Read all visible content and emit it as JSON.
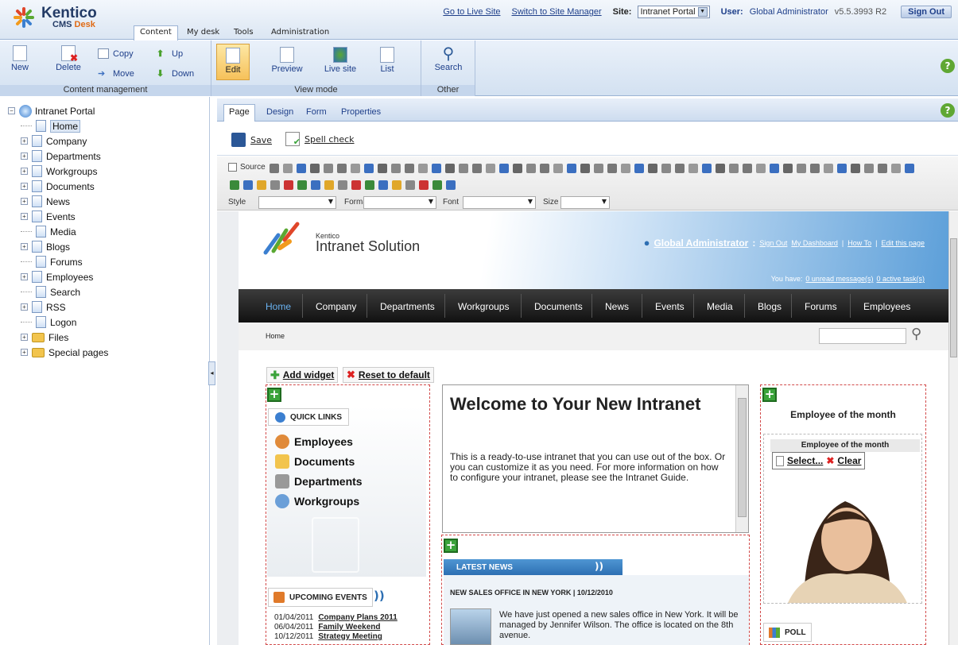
{
  "app": {
    "logo_text": "Kentico",
    "logo_sub_1": "CMS",
    "logo_sub_2": "Desk"
  },
  "main_tabs": [
    {
      "label": "Content"
    },
    {
      "label": "My desk"
    },
    {
      "label": "Tools"
    },
    {
      "label": "Administration"
    }
  ],
  "top_links": {
    "live_site": "Go to Live Site",
    "site_manager": "Switch to Site Manager",
    "site_label": "Site:",
    "site_value": "Intranet Portal",
    "user_label": "User:",
    "user_value": "Global Administrator",
    "version": "v5.5.3993 R2",
    "sign_out": "Sign Out"
  },
  "ribbon": {
    "content_management": {
      "label": "Content management",
      "new": "New",
      "delete": "Delete",
      "copy": "Copy",
      "move": "Move",
      "up": "Up",
      "down": "Down"
    },
    "view_mode": {
      "label": "View mode",
      "edit": "Edit",
      "preview": "Preview",
      "live_site": "Live site",
      "list": "List"
    },
    "other": {
      "label": "Other",
      "search": "Search"
    },
    "help": "?"
  },
  "tree": {
    "root": "Intranet Portal",
    "items": [
      {
        "label": "Home",
        "expandable": false,
        "selected": true
      },
      {
        "label": "Company",
        "expandable": true
      },
      {
        "label": "Departments",
        "expandable": true
      },
      {
        "label": "Workgroups",
        "expandable": true
      },
      {
        "label": "Documents",
        "expandable": true
      },
      {
        "label": "News",
        "expandable": true
      },
      {
        "label": "Events",
        "expandable": true
      },
      {
        "label": "Media",
        "expandable": false
      },
      {
        "label": "Blogs",
        "expandable": true
      },
      {
        "label": "Forums",
        "expandable": false
      },
      {
        "label": "Employees",
        "expandable": true
      },
      {
        "label": "Search",
        "expandable": false
      },
      {
        "label": "RSS",
        "expandable": true
      },
      {
        "label": "Logon",
        "expandable": false
      },
      {
        "label": "Files",
        "expandable": true,
        "folder": true
      },
      {
        "label": "Special pages",
        "expandable": true,
        "folder": true
      }
    ]
  },
  "edit_tabs": [
    {
      "label": "Page"
    },
    {
      "label": "Design"
    },
    {
      "label": "Form"
    },
    {
      "label": "Properties"
    }
  ],
  "savebar": {
    "save": "Save",
    "spell_check": "Spell check"
  },
  "editor_toolbar": {
    "source": "Source",
    "style": "Style",
    "format": "Format",
    "font": "Font",
    "size": "Size"
  },
  "site": {
    "brand_small": "Kentico",
    "brand": "Intranet Solution",
    "user": "Global Administrator",
    "header_links": [
      "Sign Out",
      "My Dashboard",
      "How To",
      "Edit this page"
    ],
    "messages_prefix": "You have:",
    "unread": "0 unread message(s)",
    "tasks": "0 active task(s)",
    "nav": [
      "Home",
      "Company",
      "Departments",
      "Workgroups",
      "Documents",
      "News",
      "Events",
      "Media",
      "Blogs",
      "Forums",
      "Employees"
    ],
    "breadcrumb": "Home",
    "add_widget": "Add widget",
    "reset_default": "Reset to default",
    "quick_links_title": "QUICK LINKS",
    "quick_links": [
      "Employees",
      "Documents",
      "Departments",
      "Workgroups"
    ],
    "welcome_title": "Welcome to Your New Intranet",
    "welcome_text": "This is a ready-to-use intranet that you can use out of the box. Or you can customize it as you need. For more information on how to configure your intranet, please see the Intranet Guide.",
    "employee_heading": "Employee of the month",
    "employee_box_title": "Employee of the month",
    "select": "Select...",
    "clear": "Clear",
    "latest_news": "LATEST NEWS",
    "news_headline": "NEW SALES OFFICE IN NEW YORK | 10/12/2010",
    "news_text": "We have just opened a new sales office in New York. It will be managed by Jennifer Wilson. The office is located on the 8th avenue.",
    "upcoming_events": "UPCOMING EVENTS",
    "events": [
      {
        "date": "01/04/2011",
        "title": "Company Plans 2011"
      },
      {
        "date": "06/04/2011",
        "title": "Family Weekend"
      },
      {
        "date": "10/12/2011",
        "title": "Strategy Meeting"
      }
    ],
    "poll": "POLL"
  }
}
